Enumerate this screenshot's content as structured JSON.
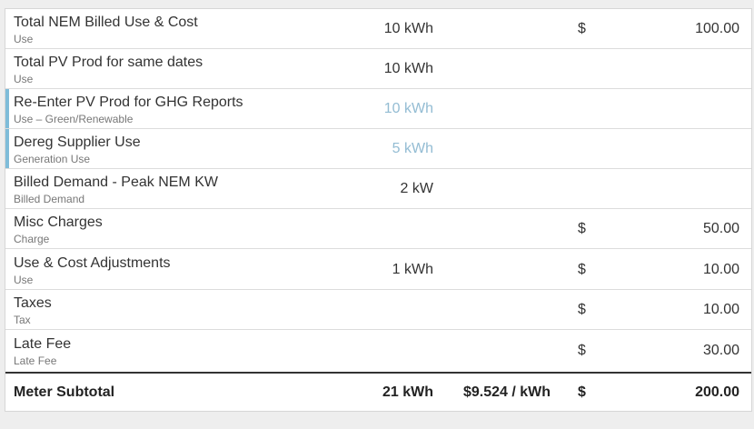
{
  "colors": {
    "accent": "#7fbcd9",
    "muted_value": "#93bcd3"
  },
  "rows": [
    {
      "label": "Total NEM Billed Use & Cost",
      "sublabel": "Use",
      "qty": "10 kWh",
      "currency": "$",
      "amount": "100.00"
    },
    {
      "label": "Total PV Prod for same dates",
      "sublabel": "Use",
      "qty": "10 kWh",
      "currency": "",
      "amount": ""
    },
    {
      "label": "Re-Enter PV Prod for GHG Reports",
      "sublabel": "Use – Green/Renewable",
      "qty": "10 kWh",
      "currency": "",
      "amount": ""
    },
    {
      "label": "Dereg Supplier Use",
      "sublabel": "Generation Use",
      "qty": "5 kWh",
      "currency": "",
      "amount": ""
    },
    {
      "label": "Billed Demand - Peak NEM KW",
      "sublabel": "Billed Demand",
      "qty": "2 kW",
      "currency": "",
      "amount": ""
    },
    {
      "label": "Misc Charges",
      "sublabel": "Charge",
      "qty": "",
      "currency": "$",
      "amount": "50.00"
    },
    {
      "label": "Use & Cost Adjustments",
      "sublabel": "Use",
      "qty": "1 kWh",
      "currency": "$",
      "amount": "10.00"
    },
    {
      "label": "Taxes",
      "sublabel": "Tax",
      "qty": "",
      "currency": "$",
      "amount": "10.00"
    },
    {
      "label": "Late Fee",
      "sublabel": "Late Fee",
      "qty": "",
      "currency": "$",
      "amount": "30.00"
    }
  ],
  "subtotal": {
    "label": "Meter Subtotal",
    "qty": "21 kWh",
    "rate": "$9.524 / kWh",
    "currency": "$",
    "amount": "200.00"
  }
}
